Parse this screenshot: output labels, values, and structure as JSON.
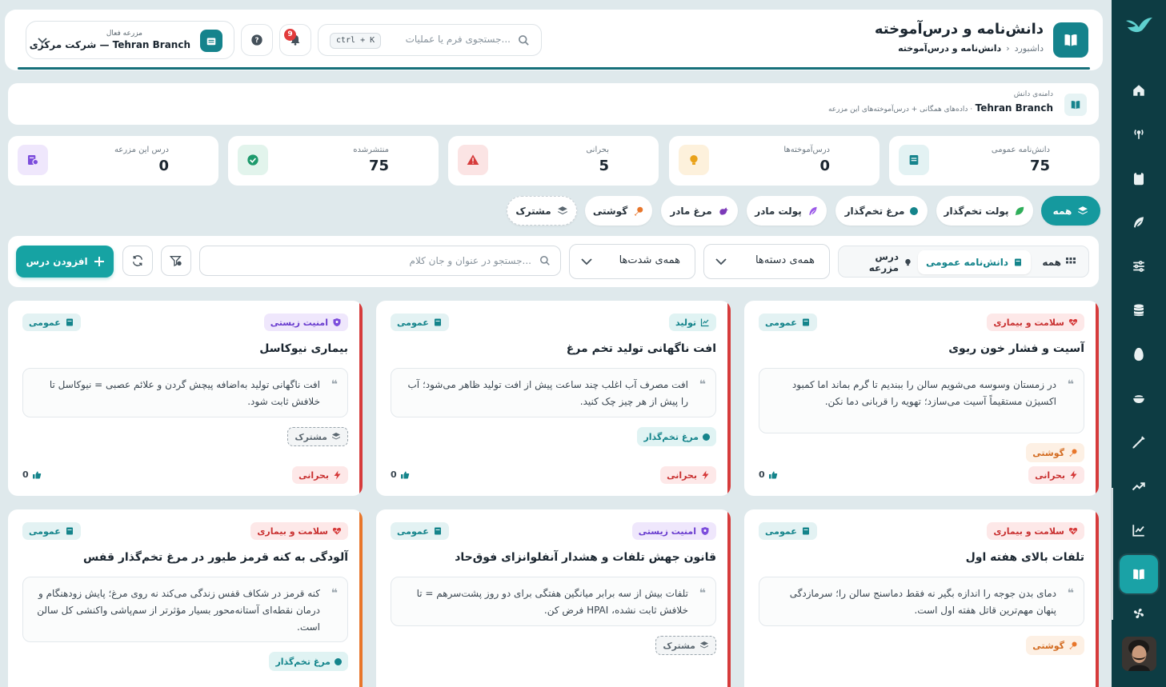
{
  "sidebar": {
    "items": [
      "home-icon",
      "radio-tower-icon",
      "clipboard-icon",
      "feather-icon",
      "sliders-icon",
      "database-icon",
      "egg-icon",
      "bowl-icon",
      "syringe-icon",
      "trending-up-icon",
      "chart-icon",
      "book-icon",
      "fan-icon"
    ],
    "active_item": "book-icon"
  },
  "header": {
    "title": "دانش‌نامه و درس‌آموخته",
    "breadcrumb": [
      "داشبورد",
      "دانش‌نامه و درس‌آموخته"
    ],
    "search_placeholder": "جستجوی فرم یا عملیات...",
    "shortcut": "ctrl + K",
    "notification_count": "9",
    "farm_caption": "مزرعه فعال",
    "farm_value": "شرکت مرکزی — Tehran Branch"
  },
  "scope": {
    "caption": "دامنه‌ی دانش",
    "farm": "Tehran Branch",
    "description": "· داده‌های همگانی + درس‌آموخته‌های این مزرعه"
  },
  "stats": [
    {
      "label": "دانش‌نامه عمومی",
      "value": "75",
      "icon": "book-icon",
      "color": "#15838c"
    },
    {
      "label": "درس‌آموخته‌ها",
      "value": "0",
      "icon": "bulb-icon",
      "color": "#e9a21a"
    },
    {
      "label": "بحرانی",
      "value": "5",
      "icon": "warning-icon",
      "color": "#d63b3b"
    },
    {
      "label": "منتشرشده",
      "value": "75",
      "icon": "check-icon",
      "color": "#1d9a6c"
    },
    {
      "label": "درس این مزرعه",
      "value": "0",
      "icon": "farm-lesson-icon",
      "color": "#7c4ddc"
    }
  ],
  "chips": [
    {
      "label": "همه",
      "icon": "layers-icon"
    },
    {
      "label": "پولت تخم‌گذار",
      "icon": "leaf-icon"
    },
    {
      "label": "مرغ تخم‌گذار",
      "icon": "dot-icon"
    },
    {
      "label": "پولت مادر",
      "icon": "feather-icon"
    },
    {
      "label": "مرغ مادر",
      "icon": "bird-icon"
    },
    {
      "label": "گوشتی",
      "icon": "drumstick-icon"
    },
    {
      "label": "مشترک",
      "icon": "layers-icon"
    }
  ],
  "filters": {
    "segments": [
      "همه",
      "دانش‌نامه عمومی",
      "درس مزرعه"
    ],
    "active_segment": "دانش‌نامه عمومی",
    "category": "همه‌ی دسته‌ها",
    "severity": "همه‌ی شدت‌ها",
    "search_placeholder": "جستجو در عنوان و جان کلام...",
    "add_button": "افزودن درس"
  },
  "cards": [
    {
      "category": "سلامت و بیماری",
      "category_icon": "heart-pulse-icon",
      "scope": "عمومی",
      "title": "آسیت و فشار خون ریوی",
      "summary": "در زمستان وسوسه می‌شویم سالن را ببندیم تا گرم بماند اما کمبود اکسیژن مستقیماً آسیت می‌سازد؛ تهویه را قربانی دما نکن.",
      "type": "گوشتی",
      "type_icon": "drumstick-icon",
      "severity": "بحرانی",
      "likes": "0",
      "bar_color": "#d63b3b"
    },
    {
      "category": "تولید",
      "category_icon": "chart-line-icon",
      "scope": "عمومی",
      "title": "افت ناگهانی تولید تخم مرغ",
      "summary": "افت مصرف آب اغلب چند ساعت پیش از افت تولید ظاهر می‌شود؛ آب را پیش از هر چیز چک کنید.",
      "type": "مرغ تخم‌گذار",
      "type_icon": "dot-icon",
      "severity": "بحرانی",
      "likes": "0",
      "bar_color": "#d63b3b"
    },
    {
      "category": "امنیت زیستی",
      "category_icon": "shield-icon",
      "scope": "عمومی",
      "title": "بیماری نیوکاسل",
      "summary": "افت ناگهانی تولید به‌اضافه پیچش گردن و علائم عصبی = نیوکاسل تا خلافش ثابت شود.",
      "type": "مشترک",
      "type_icon": "layers-icon",
      "severity": "بحرانی",
      "likes": "0",
      "bar_color": "#d63b3b"
    },
    {
      "category": "سلامت و بیماری",
      "category_icon": "heart-pulse-icon",
      "scope": "عمومی",
      "title": "تلفات بالای هفته اول",
      "summary": "دمای بدن جوجه را اندازه بگیر نه فقط دماسنج سالن را؛ سرمازدگی پنهان مهم‌ترین قاتل هفته اول است.",
      "type": "گوشتی",
      "type_icon": "drumstick-icon",
      "severity": "",
      "likes": "",
      "bar_color": "#d63b3b"
    },
    {
      "category": "امنیت زیستی",
      "category_icon": "shield-icon",
      "scope": "عمومی",
      "title": "قانون جهش تلفات و هشدار آنفلوانزای فوق‌حاد",
      "summary": "تلفات بیش از سه برابر میانگین هفتگی برای دو روز پشت‌سرهم = تا خلافش ثابت نشده، HPAI فرض کن.",
      "type": "مشترک",
      "type_icon": "layers-icon",
      "severity": "",
      "likes": "",
      "bar_color": "#d63b3b"
    },
    {
      "category": "سلامت و بیماری",
      "category_icon": "heart-pulse-icon",
      "scope": "عمومی",
      "title": "آلودگی به کنه قرمز طیور در مرغ تخم‌گذار قفس",
      "summary": "کنه قرمز در شکاف قفس زندگی می‌کند نه روی مرغ؛ پایش زودهنگام و درمان نقطه‌ای آستانه‌محور بسیار مؤثرتر از سم‌پاشی واکنشی کل سالن است.",
      "type": "مرغ تخم‌گذار",
      "type_icon": "dot-icon",
      "severity": "",
      "likes": "",
      "bar_color": "#e8762b"
    }
  ]
}
